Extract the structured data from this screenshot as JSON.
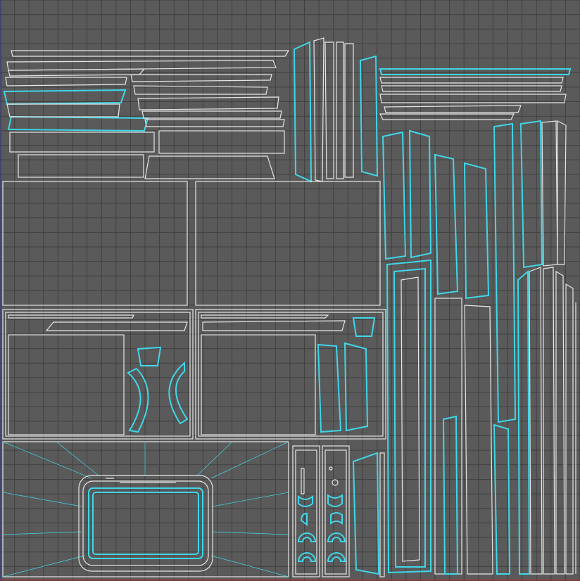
{
  "viewport": {
    "background": "#5a5a5a",
    "grid_color": "#404040",
    "grid_divisions": 40,
    "island_outline_color": "#e6e6e6",
    "island_fill_color": "#3fd6e8",
    "axis_u_color": "#c03030",
    "axis_v_color": "#2a3bd0",
    "grid_visible": true
  }
}
